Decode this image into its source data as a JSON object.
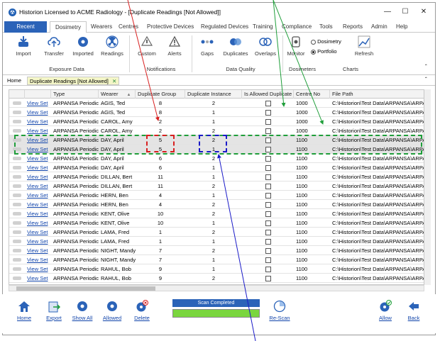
{
  "window": {
    "title": "Historion Licensed to ACME Radiology - [Duplicate Readings [Not Allowed]]",
    "logo_glyph": "☢"
  },
  "menu_tabs": [
    "Recent",
    "Dosimetry",
    "Wearers",
    "Centres",
    "Protective Devices",
    "Regulated Devices",
    "Training",
    "Compliance",
    "Tools",
    "Reports",
    "Admin",
    "Help"
  ],
  "ribbon": {
    "buttons": {
      "import": "Import",
      "transfer": "Transfer",
      "imported": "Imported",
      "readings": "Readings",
      "custom": "Custom",
      "alerts": "Alerts",
      "gaps": "Gaps",
      "duplicates": "Duplicates",
      "overlaps": "Overlaps",
      "monitor": "Monitor",
      "refresh": "Refresh"
    },
    "radio": {
      "dosimetry": "Dosimetry",
      "portfolio": "Portfolio",
      "selected": "Portfolio"
    },
    "groups": {
      "exposure": "Exposure Data",
      "notifications": "Notifications",
      "quality": "Data Quality",
      "dosimeters": "Dosimeters",
      "charts": "Charts"
    }
  },
  "doc_tabs": {
    "home": "Home",
    "current": "Duplicate Readings [Not Allowed]"
  },
  "grid": {
    "columns": [
      "Type",
      "Wearer",
      "Duplicate Group",
      "Duplicate Instance",
      "Is Allowed Duplicate",
      "Centre No",
      "File Path"
    ],
    "sort_indicator": "▲",
    "link_text": "View Set",
    "rows": [
      {
        "type": "ARPANSA Periodic",
        "wearer": "AGIS, Ted",
        "group": "8",
        "instance": "2",
        "centre": "1000",
        "path": "C:\\Historion\\Test Data\\ARPANSA\\ARPA"
      },
      {
        "type": "ARPANSA Periodic",
        "wearer": "AGIS, Ted",
        "group": "8",
        "instance": "1",
        "centre": "1000",
        "path": "C:\\Historion\\Test Data\\ARPANSA\\ARPA"
      },
      {
        "type": "ARPANSA Periodic",
        "wearer": "CAROL, Amy",
        "group": "2",
        "instance": "1",
        "centre": "1000",
        "path": "C:\\Historion\\Test Data\\ARPANSA\\ARPA"
      },
      {
        "type": "ARPANSA Periodic",
        "wearer": "CAROL, Amy",
        "group": "2",
        "instance": "2",
        "centre": "1000",
        "path": "C:\\Historion\\Test Data\\ARPANSA\\ARPA"
      },
      {
        "type": "ARPANSA Periodic",
        "wearer": "DAY, April",
        "group": "5",
        "instance": "2",
        "centre": "1100",
        "path": "C:\\Historion\\Test Data\\ARPANSA\\ARPA"
      },
      {
        "type": "ARPANSA Periodic",
        "wearer": "DAY, April",
        "group": "5",
        "instance": "1",
        "centre": "1100",
        "path": "C:\\Historion\\Test Data\\ARPANSA\\ARPA"
      },
      {
        "type": "ARPANSA Periodic",
        "wearer": "DAY, April",
        "group": "6",
        "instance": "2",
        "centre": "1100",
        "path": "C:\\Historion\\Test Data\\ARPANSA\\ARPA"
      },
      {
        "type": "ARPANSA Periodic",
        "wearer": "DAY, April",
        "group": "6",
        "instance": "1",
        "centre": "1100",
        "path": "C:\\Historion\\Test Data\\ARPANSA\\ARPA"
      },
      {
        "type": "ARPANSA Periodic",
        "wearer": "DILLAN, Bert",
        "group": "11",
        "instance": "1",
        "centre": "1100",
        "path": "C:\\Historion\\Test Data\\ARPANSA\\ARPA"
      },
      {
        "type": "ARPANSA Periodic",
        "wearer": "DILLAN, Bert",
        "group": "11",
        "instance": "2",
        "centre": "1100",
        "path": "C:\\Historion\\Test Data\\ARPANSA\\ARPA"
      },
      {
        "type": "ARPANSA Periodic",
        "wearer": "HERN, Ben",
        "group": "4",
        "instance": "1",
        "centre": "1100",
        "path": "C:\\Historion\\Test Data\\ARPANSA\\ARPA"
      },
      {
        "type": "ARPANSA Periodic",
        "wearer": "HERN, Ben",
        "group": "4",
        "instance": "2",
        "centre": "1100",
        "path": "C:\\Historion\\Test Data\\ARPANSA\\ARPA"
      },
      {
        "type": "ARPANSA Periodic",
        "wearer": "KENT, Olive",
        "group": "10",
        "instance": "2",
        "centre": "1100",
        "path": "C:\\Historion\\Test Data\\ARPANSA\\ARPA"
      },
      {
        "type": "ARPANSA Periodic",
        "wearer": "KENT, Olive",
        "group": "10",
        "instance": "1",
        "centre": "1100",
        "path": "C:\\Historion\\Test Data\\ARPANSA\\ARPA"
      },
      {
        "type": "ARPANSA Periodic",
        "wearer": "LAMA, Fred",
        "group": "1",
        "instance": "2",
        "centre": "1100",
        "path": "C:\\Historion\\Test Data\\ARPANSA\\ARPA"
      },
      {
        "type": "ARPANSA Periodic",
        "wearer": "LAMA, Fred",
        "group": "1",
        "instance": "1",
        "centre": "1100",
        "path": "C:\\Historion\\Test Data\\ARPANSA\\ARPA"
      },
      {
        "type": "ARPANSA Periodic",
        "wearer": "NIGHT, Mandy",
        "group": "7",
        "instance": "2",
        "centre": "1100",
        "path": "C:\\Historion\\Test Data\\ARPANSA\\ARPA"
      },
      {
        "type": "ARPANSA Periodic",
        "wearer": "NIGHT, Mandy",
        "group": "7",
        "instance": "1",
        "centre": "1100",
        "path": "C:\\Historion\\Test Data\\ARPANSA\\ARPA"
      },
      {
        "type": "ARPANSA Periodic",
        "wearer": "RAHUL, Bob",
        "group": "9",
        "instance": "1",
        "centre": "1100",
        "path": "C:\\Historion\\Test Data\\ARPANSA\\ARPA"
      },
      {
        "type": "ARPANSA Periodic",
        "wearer": "RAHUL, Bob",
        "group": "9",
        "instance": "2",
        "centre": "1100",
        "path": "C:\\Historion\\Test Data\\ARPANSA\\ARPA"
      }
    ]
  },
  "bottom": {
    "home": "Home",
    "export": "Export",
    "show_all": "Show All",
    "allowed": "Allowed",
    "delete": "Delete",
    "scan_status": "Scan Completed",
    "scan_progress": 1.0,
    "rescan": "Re-Scan",
    "allow": "Allow",
    "back": "Back"
  },
  "colors": {
    "accent": "#2b63b8",
    "link": "#1144aa",
    "progress": "#7ad63e",
    "green_dash": "#1f9e3a",
    "red_dash": "#d82020",
    "blue_dash": "#1a1ac8",
    "highlight_tab": "#f4f6c8"
  }
}
